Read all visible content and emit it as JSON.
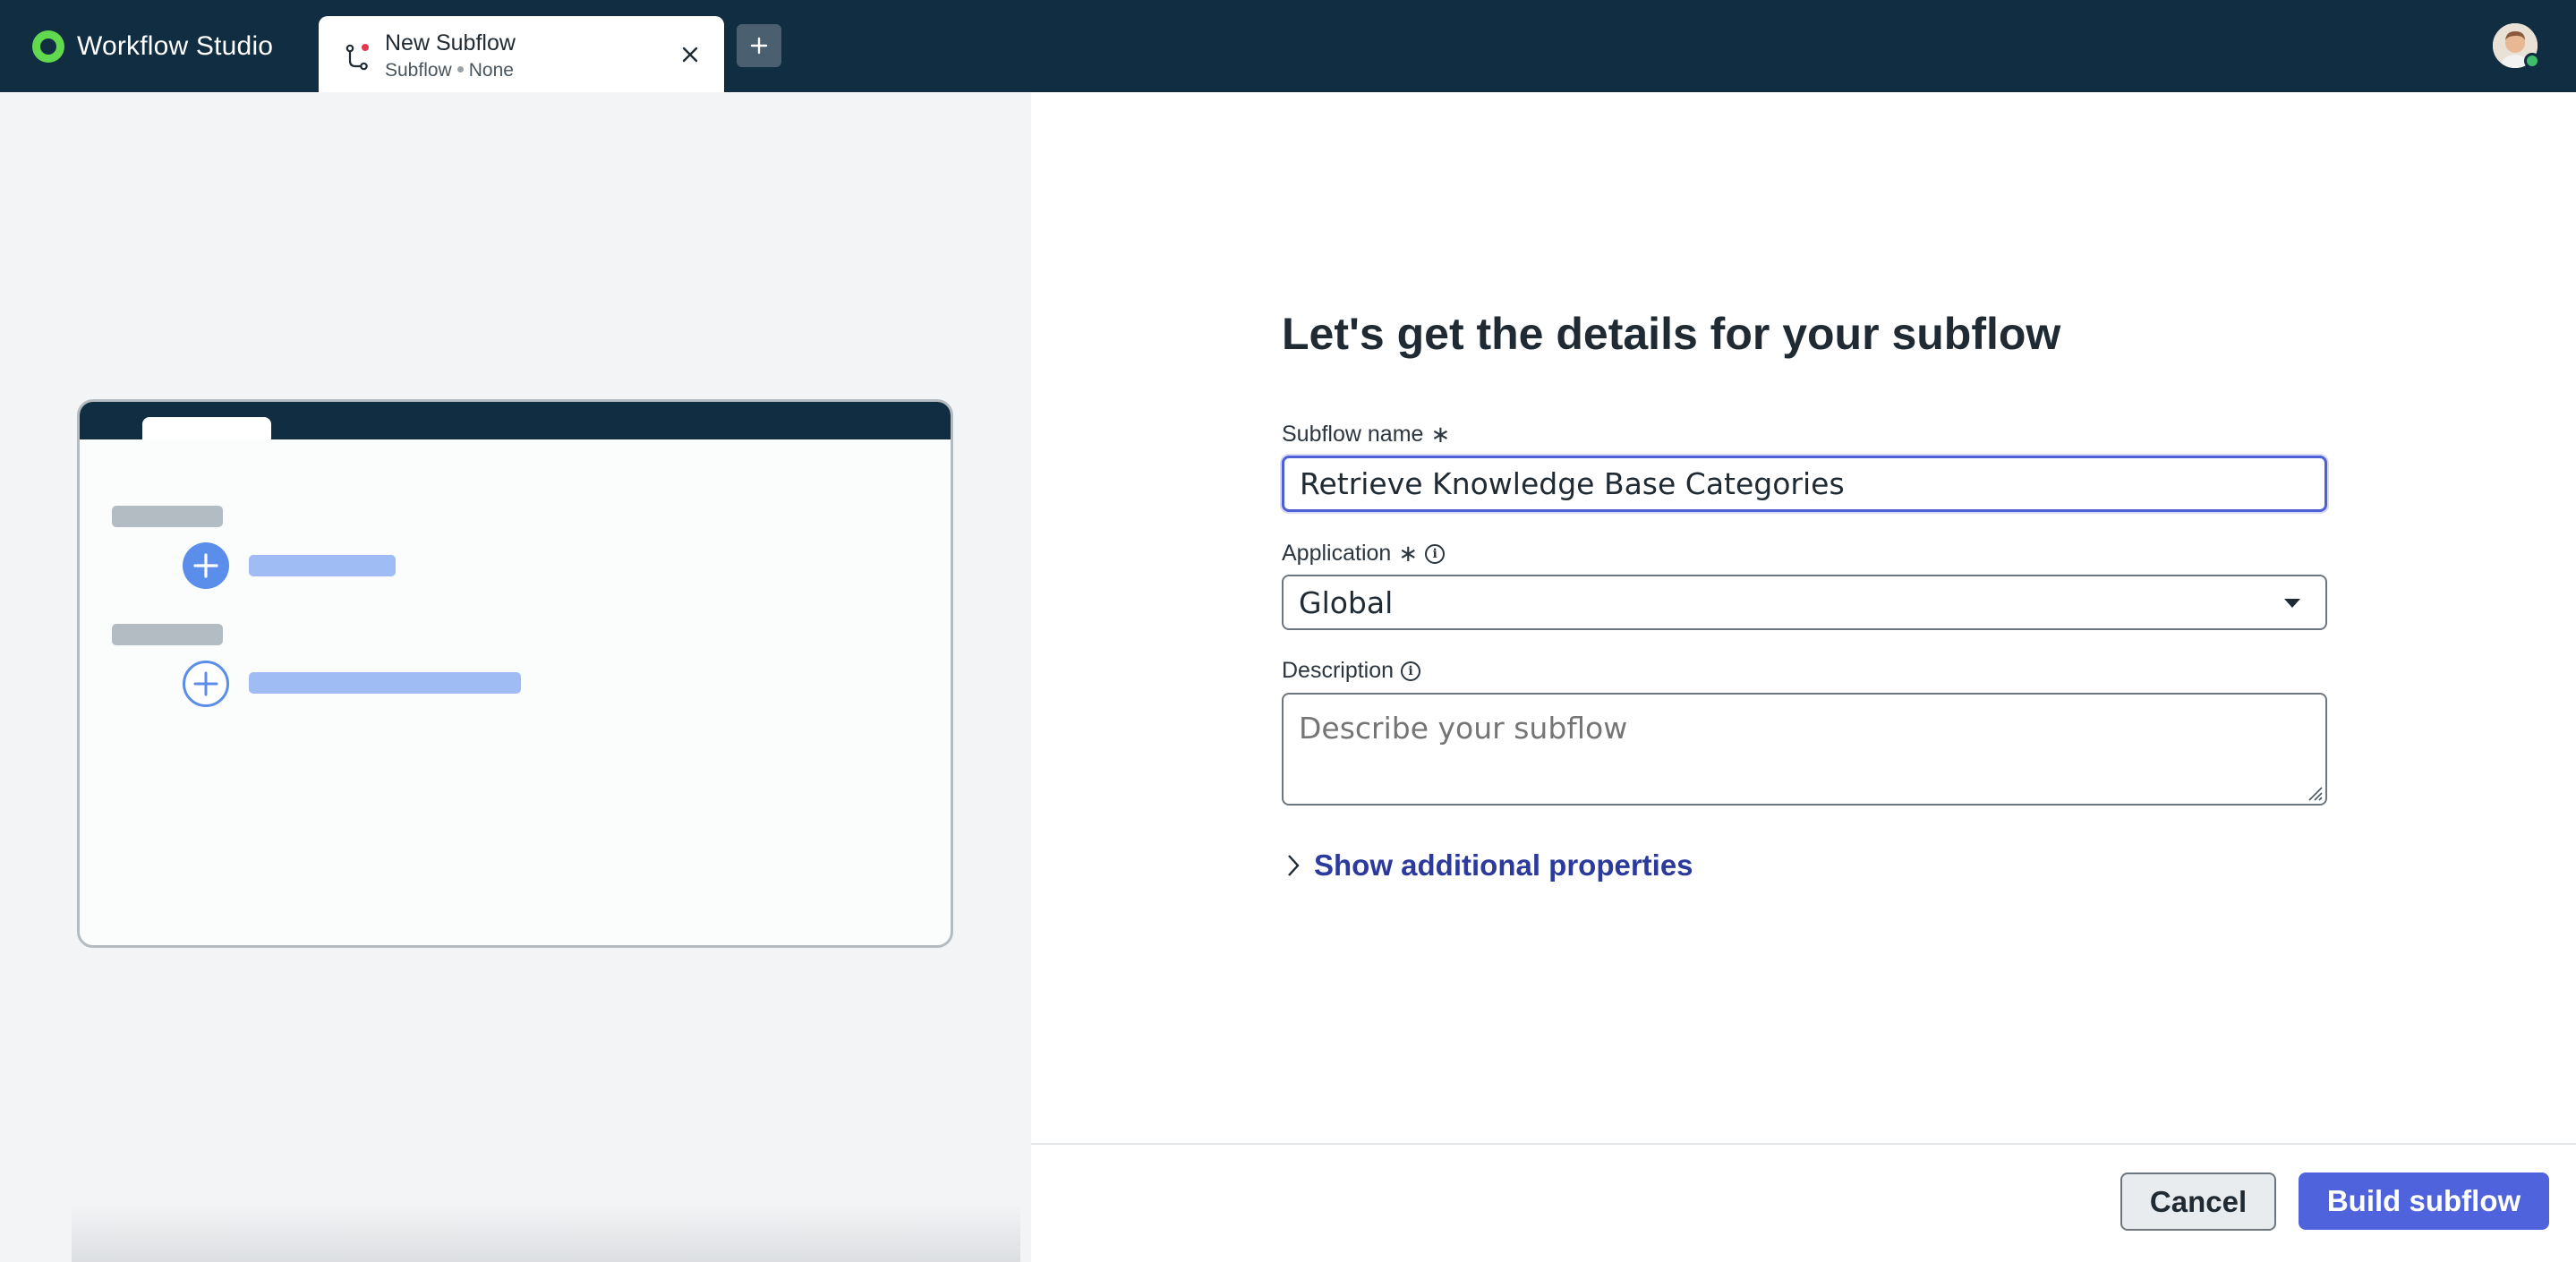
{
  "app": {
    "name": "Workflow Studio",
    "brand_color": "#62d84e",
    "topbar_color": "#112d41"
  },
  "tab": {
    "title": "New Subflow",
    "type": "Subflow",
    "scope": "None",
    "icon": "subflow-branch-icon",
    "unsaved_indicator_color": "#e5384f"
  },
  "header": {
    "add_tab_icon": "plus-icon",
    "avatar_icon": "user-avatar"
  },
  "form": {
    "heading": "Let's get the details for your subflow",
    "subflow_name": {
      "label": "Subflow name",
      "required_marker": "∗",
      "value": "Retrieve Knowledge Base Categories"
    },
    "application": {
      "label": "Application",
      "required_marker": "∗",
      "info_icon": "i",
      "value": "Global"
    },
    "description": {
      "label": "Description",
      "info_icon": "i",
      "placeholder": "Describe your subflow",
      "value": ""
    },
    "show_additional": "Show additional properties"
  },
  "footer": {
    "cancel_label": "Cancel",
    "build_label": "Build subflow",
    "primary_color": "#4f63dd"
  }
}
